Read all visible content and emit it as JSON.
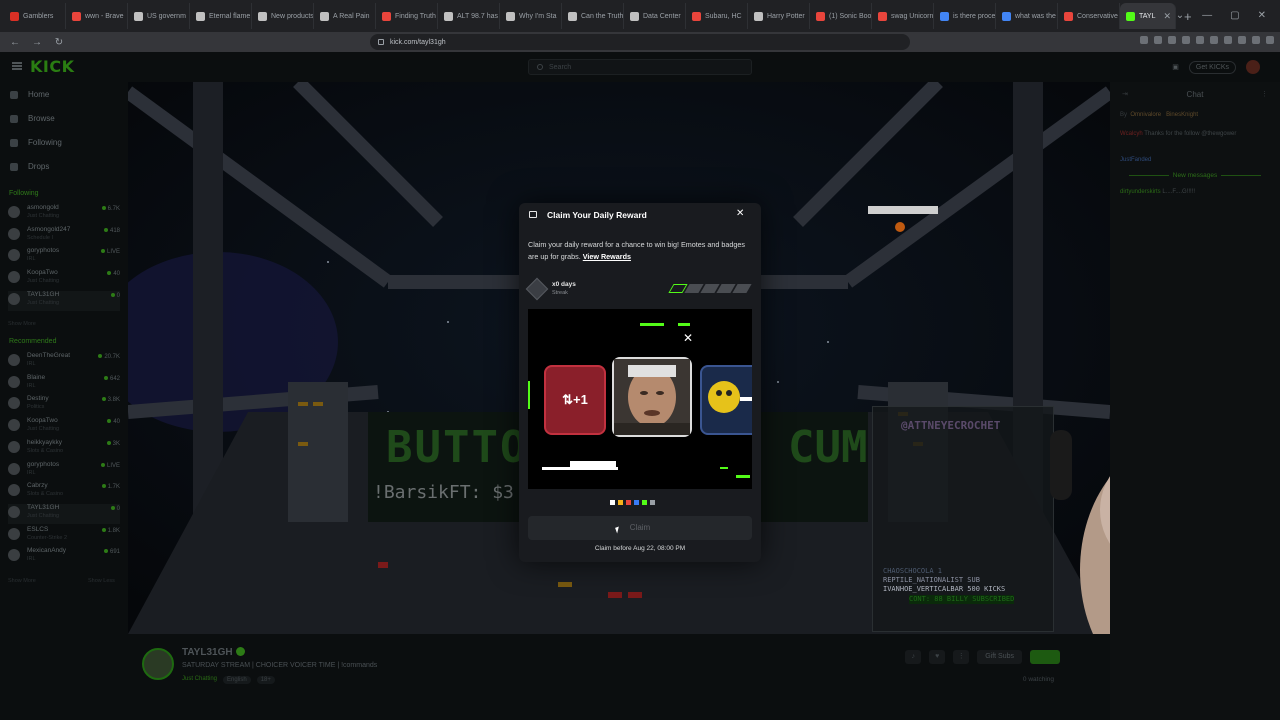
{
  "browser": {
    "tabs": [
      {
        "label": "Gamblers",
        "color": "#d93025"
      },
      {
        "label": "wwn - Brave",
        "color": "#e8453c"
      },
      {
        "label": "US governm",
        "color": "#c0c0c0"
      },
      {
        "label": "Eternal flame",
        "color": "#c0c0c0"
      },
      {
        "label": "New products",
        "color": "#c0c0c0"
      },
      {
        "label": "A Real Pain",
        "color": "#c0c0c0"
      },
      {
        "label": "Finding Truth",
        "color": "#e8453c"
      },
      {
        "label": "ALT 98.7 has",
        "color": "#c0c0c0"
      },
      {
        "label": "Why I'm Sta",
        "color": "#c0c0c0"
      },
      {
        "label": "Can the Truth",
        "color": "#c0c0c0"
      },
      {
        "label": "Data Center",
        "color": "#c0c0c0"
      },
      {
        "label": "Subaru, HC",
        "color": "#e8453c"
      },
      {
        "label": "Harry Potter",
        "color": "#c0c0c0"
      },
      {
        "label": "(1) Sonic Boo",
        "color": "#e8453c"
      },
      {
        "label": "swag Unicorn",
        "color": "#e8453c"
      },
      {
        "label": "is there proce",
        "color": "#4285f4"
      },
      {
        "label": "what was the",
        "color": "#4285f4"
      },
      {
        "label": "Conservative",
        "color": "#e8453c"
      },
      {
        "label": "TAYL",
        "color": "#53fc18"
      }
    ],
    "url": "kick.com/tayl31gh"
  },
  "kick": {
    "logo": "KICK",
    "search_placeholder": "Search",
    "get_kicks": "Get KICKs"
  },
  "sidebar": {
    "nav": [
      "Home",
      "Browse",
      "Following",
      "Drops"
    ],
    "following_title": "Following",
    "following": [
      {
        "name": "asmongold",
        "category": "Just Chatting",
        "viewers": "6.7K"
      },
      {
        "name": "Asmongold247",
        "category": "Schedule I",
        "viewers": "418"
      },
      {
        "name": "goryphotos",
        "category": "IRL",
        "viewers": "LIVE"
      },
      {
        "name": "KoopaTwo",
        "category": "Just Chatting",
        "viewers": "40"
      },
      {
        "name": "TAYL31GH",
        "category": "Just Chatting",
        "viewers": "0"
      }
    ],
    "show_more": "Show More",
    "recommended_title": "Recommended",
    "recommended": [
      {
        "name": "DeenTheGreat",
        "category": "IRL",
        "viewers": "20.7K"
      },
      {
        "name": "Blaine",
        "category": "IRL",
        "viewers": "642"
      },
      {
        "name": "Destiny",
        "category": "Politics",
        "viewers": "3.8K"
      },
      {
        "name": "KoopaTwo",
        "category": "Just Chatting",
        "viewers": "40"
      },
      {
        "name": "heikkyaykky",
        "category": "Slots & Casino",
        "viewers": "3K"
      },
      {
        "name": "goryphotos",
        "category": "IRL",
        "viewers": "LIVE"
      },
      {
        "name": "Cabrzy",
        "category": "Slots & Casino",
        "viewers": "1.7K"
      },
      {
        "name": "TAYL31GH",
        "category": "Just Chatting",
        "viewers": "0"
      },
      {
        "name": "ESLCS",
        "category": "Counter-Strike 2",
        "viewers": "1.8K"
      },
      {
        "name": "MexicanAndy",
        "category": "IRL",
        "viewers": "691"
      }
    ],
    "show_more_2": "Show More",
    "show_less": "Show Less"
  },
  "stream": {
    "overlay_top": "@ATTNEYECROCHET",
    "overlay_lines": [
      "CHAOSCHOCOLA 1",
      "REPTILE_NATIONALIST SUB",
      "IVANHOE_VERTICALBAR 500 KICKS",
      "CONT: 88 BILLY SUBSCRIBED"
    ],
    "marquee_left": "BUTTON",
    "marquee_right": "CUM",
    "ticker": "!BarsikFT: $3"
  },
  "info": {
    "streamer": "TAYL31GH",
    "title": "SATURDAY STREAM | CHOICER VOICER TIME | !commands",
    "category": "Just Chatting",
    "language": "English",
    "age": "18+",
    "gift_subs": "Gift Subs",
    "watching": "0 watching"
  },
  "chat": {
    "title": "Chat",
    "pinned_by": "By",
    "pinned_users": [
      "Omnivalore",
      "BinesKnight"
    ],
    "messages": [
      {
        "user": "Wcalcyh",
        "text": "Thanks for the follow @thewgower"
      },
      {
        "user": "JustFanded",
        "text": ""
      }
    ],
    "new_messages": "New messages",
    "last_message": {
      "user": "dirtyunderskirts",
      "text": "L....F....G!!!!!"
    }
  },
  "modal": {
    "title": "Claim Your Daily Reward",
    "description": "Claim your daily reward for a chance to win big! Emotes and badges are up for grabs.",
    "view_rewards": "View Rewards",
    "streak_days": "x0 days",
    "streak_label": "Streak",
    "streak_progress": 1,
    "streak_total": 5,
    "tile_left": "⇅+1",
    "claim": "Claim",
    "claim_before": "Claim before Aug 22, 08:00 PM",
    "dot_colors": [
      "#ffffff",
      "#f7b21b",
      "#e8453c",
      "#3a7bf6",
      "#53fc18",
      "#9aa0a6"
    ],
    "accent": "#53fc18"
  }
}
